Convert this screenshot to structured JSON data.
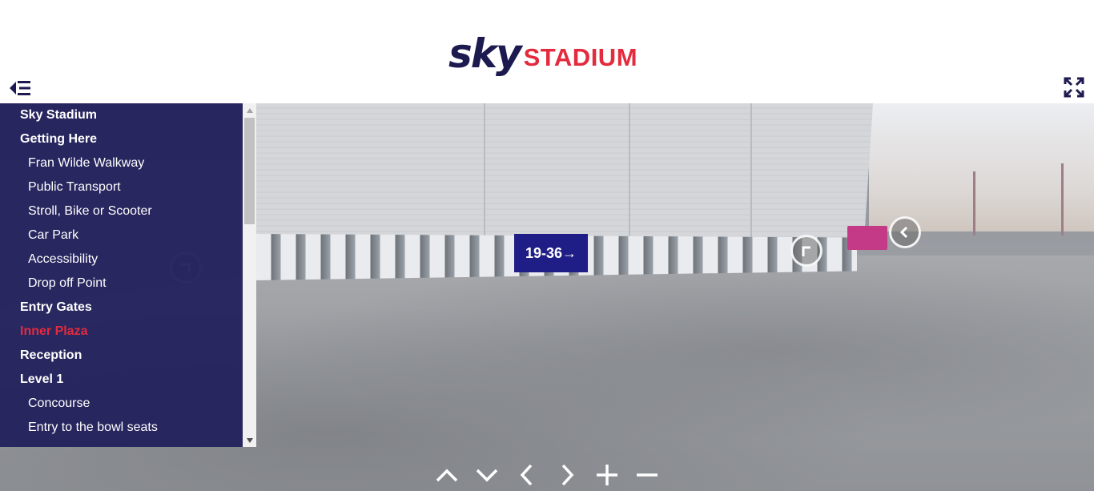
{
  "brand": {
    "logo_word": "sky",
    "logo_sub": "STADIUM",
    "accent_color": "#e42a3d",
    "navy_color": "#1d1a4f"
  },
  "header": {
    "menu_toggle_icon": "menu-collapse-icon",
    "fullscreen_icon": "fullscreen-icon"
  },
  "menu": {
    "items": [
      {
        "label": "Sky Stadium",
        "level": "section"
      },
      {
        "label": "Getting Here",
        "level": "section"
      },
      {
        "label": "Fran Wilde Walkway",
        "level": "sub"
      },
      {
        "label": "Public Transport",
        "level": "sub"
      },
      {
        "label": "Stroll, Bike or Scooter",
        "level": "sub"
      },
      {
        "label": "Car Park",
        "level": "sub"
      },
      {
        "label": "Accessibility",
        "level": "sub"
      },
      {
        "label": "Drop off Point",
        "level": "sub"
      },
      {
        "label": "Entry Gates",
        "level": "section"
      },
      {
        "label": "Inner Plaza",
        "level": "section",
        "active": true
      },
      {
        "label": "Reception",
        "level": "section"
      },
      {
        "label": "Level 1",
        "level": "section"
      },
      {
        "label": "Concourse",
        "level": "sub"
      },
      {
        "label": "Entry to the bowl seats",
        "level": "sub"
      }
    ]
  },
  "scene": {
    "banner_text": "19-36→",
    "hotspots": [
      "turn-right-hotspot-icon",
      "chevron-left-hotspot-icon",
      "turn-left-hotspot-icon"
    ]
  },
  "controls": {
    "icons": [
      "chevron-up-icon",
      "chevron-down-icon",
      "chevron-left-icon",
      "chevron-right-icon",
      "zoom-in-icon",
      "zoom-out-icon"
    ]
  }
}
